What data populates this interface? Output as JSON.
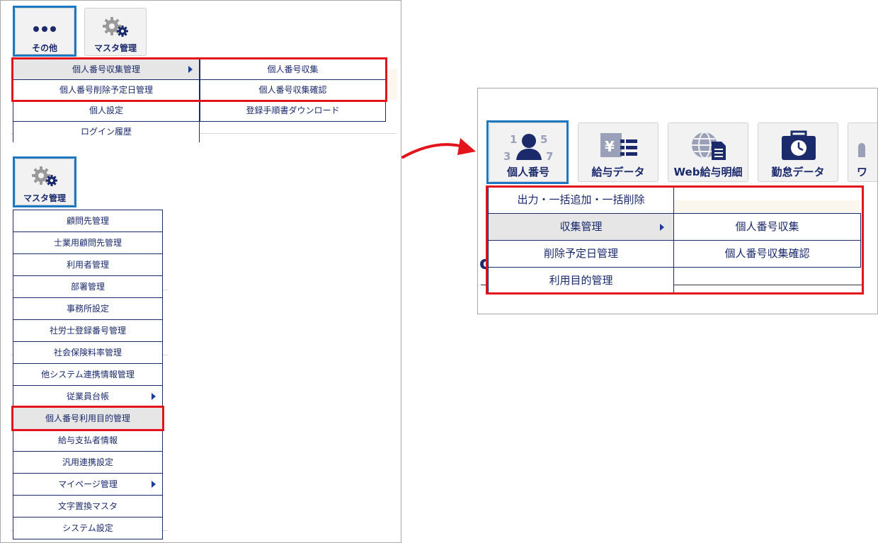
{
  "left_panel": {
    "sono_ta_label": "その他",
    "master_label": "マスタ管理",
    "sono_ta_menu": {
      "left_items": [
        "個人番号収集管理",
        "個人番号削除予定日管理",
        "個人設定",
        "ログイン履歴"
      ],
      "right_items": [
        "個人番号収集",
        "個人番号収集確認",
        "登録手順書ダウンロード"
      ]
    },
    "master_menu": {
      "items": [
        "顧問先管理",
        "士業用顧問先管理",
        "利用者管理",
        "部署管理",
        "事務所設定",
        "社労士登録番号管理",
        "社会保険料率管理",
        "他システム連携情報管理",
        "従業員台帳",
        "個人番号利用目的管理",
        "給与支払者情報",
        "汎用連携設定",
        "マイページ管理",
        "文字置換マスタ",
        "システム設定"
      ]
    }
  },
  "right_panel": {
    "toolbar": [
      "個人番号",
      "給与データ",
      "Web給与明細",
      "勤怠データ",
      "ワ"
    ],
    "menu_left": [
      "出力・一括追加・一括削除",
      "収集管理",
      "削除予定日管理",
      "利用目的管理"
    ],
    "menu_right": [
      "個人番号収集",
      "個人番号収集確認"
    ],
    "number_glyphs": [
      "1",
      "5",
      "3",
      "7"
    ],
    "yen_glyph": "¥",
    "partial_text": "c"
  },
  "colors": {
    "navy": "#1b2a6b",
    "selection_blue": "#1c78c0",
    "highlight_red": "#e3141b",
    "arrow_red": "#e3141b"
  },
  "icons": [
    "ellipsis-icon",
    "gear-icon",
    "person-number-icon",
    "yen-list-icon",
    "globe-doc-icon",
    "clock-case-icon",
    "arrow-curve-icon",
    "submenu-chevron-icon"
  ]
}
